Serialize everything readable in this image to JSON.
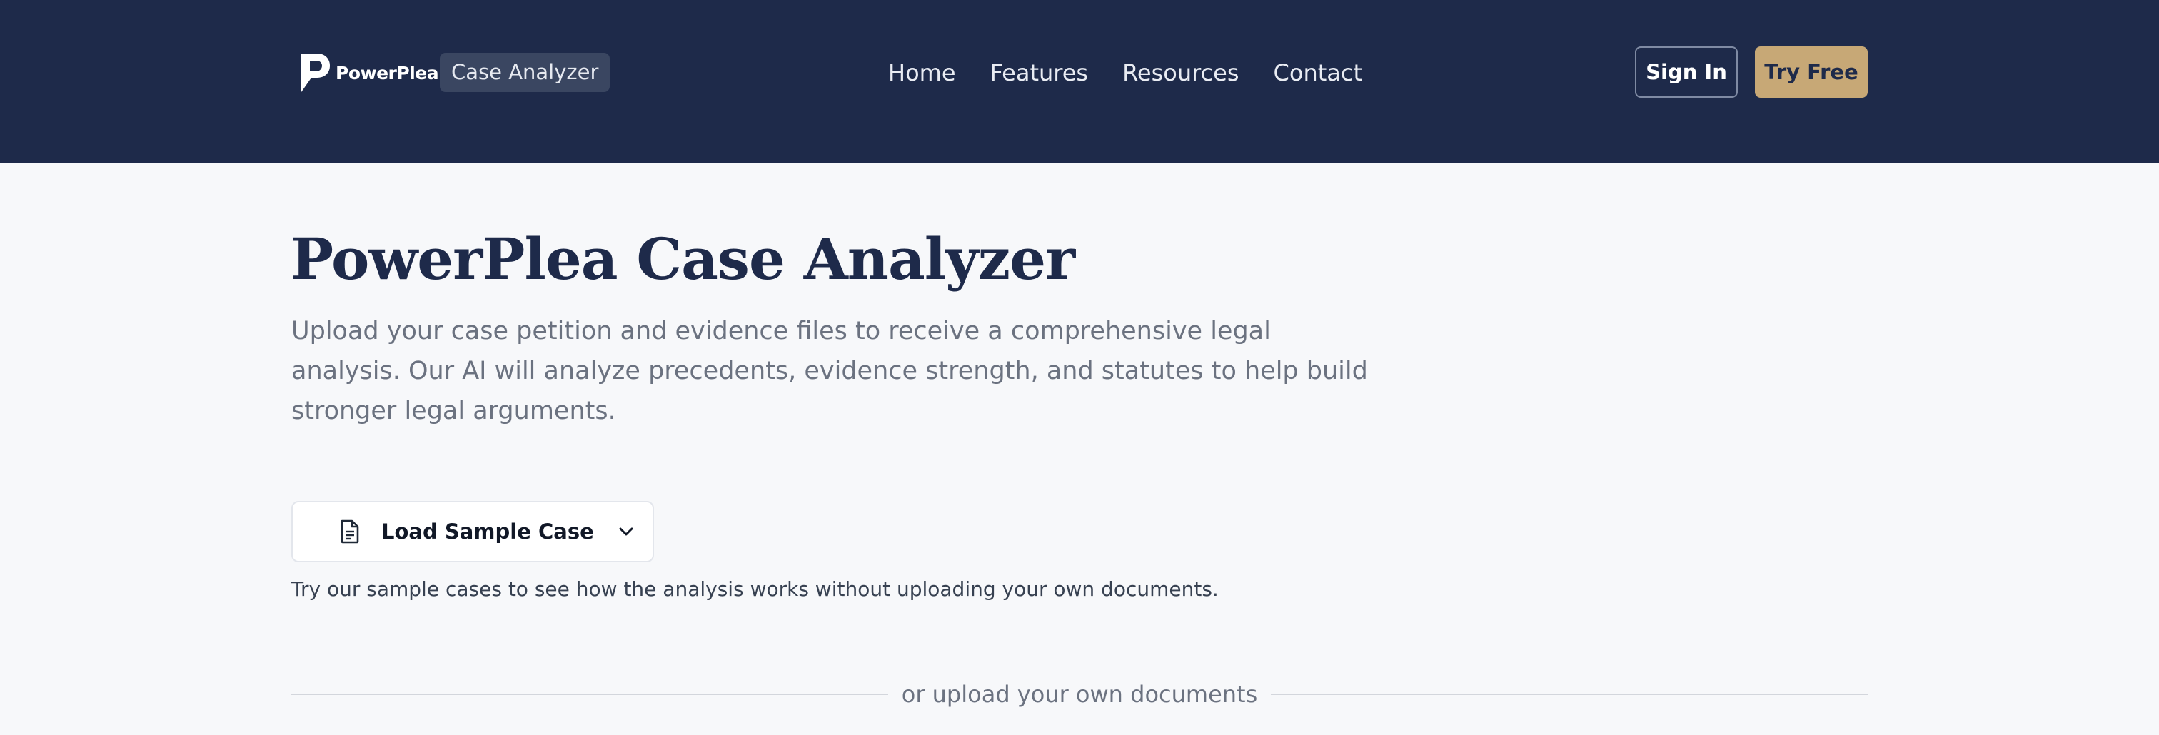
{
  "header": {
    "logo_text": "PowerPlea",
    "app_badge": "Case Analyzer",
    "nav": [
      {
        "label": "Home"
      },
      {
        "label": "Features"
      },
      {
        "label": "Resources"
      },
      {
        "label": "Contact"
      }
    ],
    "signin_label": "Sign In",
    "tryfree_label": "Try Free",
    "colors": {
      "background": "#1e2a4a",
      "accent": "#c7a876"
    }
  },
  "main": {
    "title": "PowerPlea Case Analyzer",
    "description": "Upload your case petition and evidence files to receive a comprehensive legal analysis. Our AI will analyze precedents, evidence strength, and statutes to help build stronger legal arguments.",
    "sample_button": {
      "icon": "document-icon",
      "label": "Load Sample Case",
      "dropdown_icon": "chevron-down-icon"
    },
    "hint": "Try our sample cases to see how the analysis works without uploading your own documents.",
    "divider_text": "or upload your own documents"
  }
}
